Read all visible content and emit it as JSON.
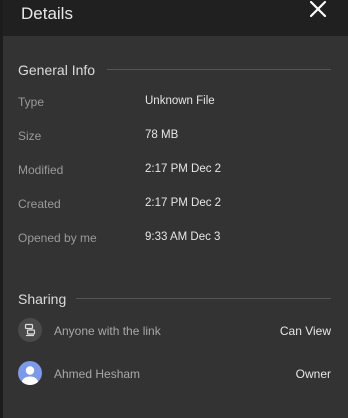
{
  "header": {
    "title": "Details",
    "close_icon": "close-icon"
  },
  "general_info": {
    "title": "General Info",
    "rows": [
      {
        "label": "Type",
        "value": "Unknown File"
      },
      {
        "label": "Size",
        "value": "78 MB"
      },
      {
        "label": "Modified",
        "value": "2:17 PM Dec 2"
      },
      {
        "label": "Created",
        "value": "2:17 PM Dec 2"
      },
      {
        "label": "Opened by me",
        "value": "9:33 AM Dec 3"
      }
    ]
  },
  "sharing": {
    "title": "Sharing",
    "entries": [
      {
        "name": "Anyone with the link",
        "role": "Can View",
        "icon": "link-icon"
      },
      {
        "name": "Ahmed Hesham",
        "role": "Owner",
        "icon": "avatar-icon"
      }
    ]
  },
  "colors": {
    "panel_bg": "#333333",
    "header_bg": "#202020",
    "avatar_blue": "#7d9ae8"
  }
}
